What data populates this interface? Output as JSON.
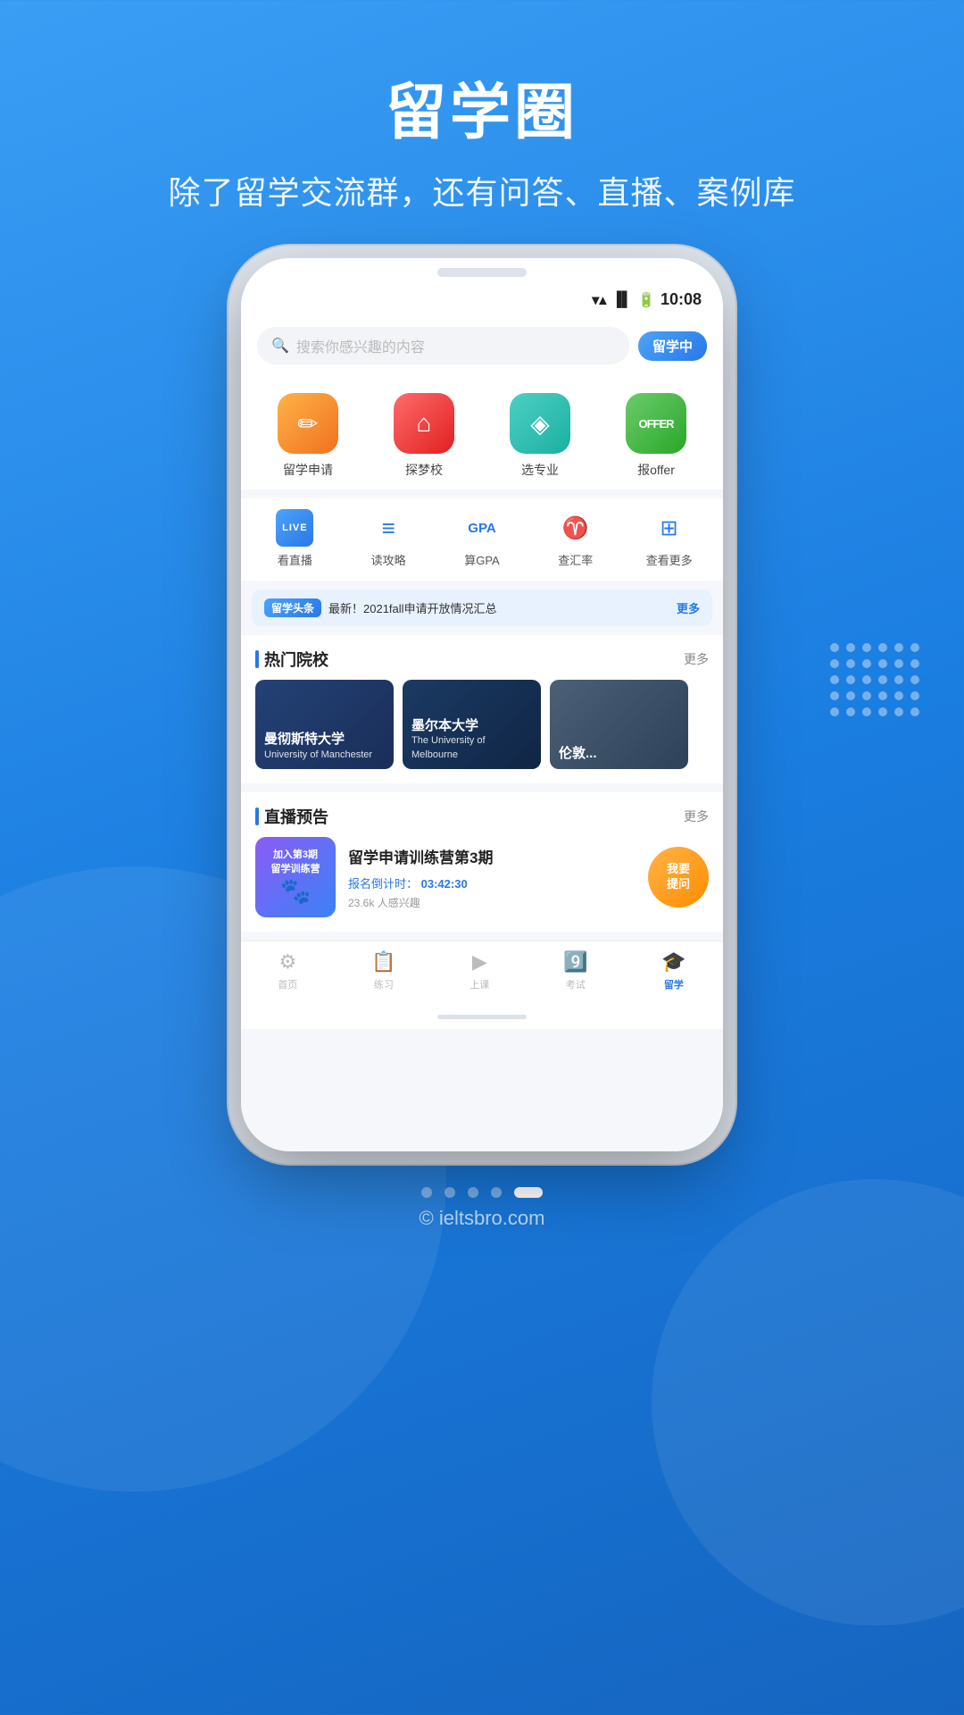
{
  "header": {
    "title": "留学圈",
    "subtitle": "除了留学交流群，还有问答、直播、案例库"
  },
  "statusBar": {
    "time": "10:08"
  },
  "search": {
    "placeholder": "搜索你感兴趣的内容",
    "badge": "留学中"
  },
  "quickActions": [
    {
      "label": "留学申请",
      "icon": "✏️",
      "colorClass": "orange"
    },
    {
      "label": "探梦校",
      "icon": "🏠",
      "colorClass": "red"
    },
    {
      "label": "选专业",
      "icon": "◈",
      "colorClass": "teal"
    },
    {
      "label": "报offer",
      "icon": "OFFER",
      "colorClass": "green"
    }
  ],
  "secondaryActions": [
    {
      "label": "看直播",
      "type": "live"
    },
    {
      "label": "读攻略",
      "type": "book"
    },
    {
      "label": "算GPA",
      "type": "gpa"
    },
    {
      "label": "查汇率",
      "type": "exchange"
    },
    {
      "label": "查看更多",
      "type": "more"
    }
  ],
  "news": {
    "tag": "留学头条",
    "text": "最新！2021fall申请开放情况汇总",
    "more": "更多"
  },
  "hotSchools": {
    "title": "热门院校",
    "more": "更多",
    "schools": [
      {
        "nameZh": "曼彻斯特大学",
        "nameEn": "University of Manchester"
      },
      {
        "nameZh": "墨尔本大学",
        "nameEn": "The University of Melbourne"
      },
      {
        "nameZh": "伦敦...",
        "nameEn": ""
      }
    ]
  },
  "livePreview": {
    "title": "直播预告",
    "more": "更多",
    "item": {
      "thumbLines": [
        "加入第3期",
        "留学训练营"
      ],
      "title": "留学申请训练营第3期",
      "countdownLabel": "报名倒计时：",
      "countdown": "03:42:30",
      "interest": "23.6k 人感兴趣",
      "btnLine1": "我要",
      "btnLine2": "提问"
    }
  },
  "bottomNav": [
    {
      "label": "首页",
      "active": false
    },
    {
      "label": "练习",
      "active": false
    },
    {
      "label": "上课",
      "active": false
    },
    {
      "label": "考试",
      "active": false
    },
    {
      "label": "留学",
      "active": true
    }
  ],
  "dots": [
    false,
    false,
    false,
    false,
    true
  ],
  "footer": "© ieltsbro.com"
}
